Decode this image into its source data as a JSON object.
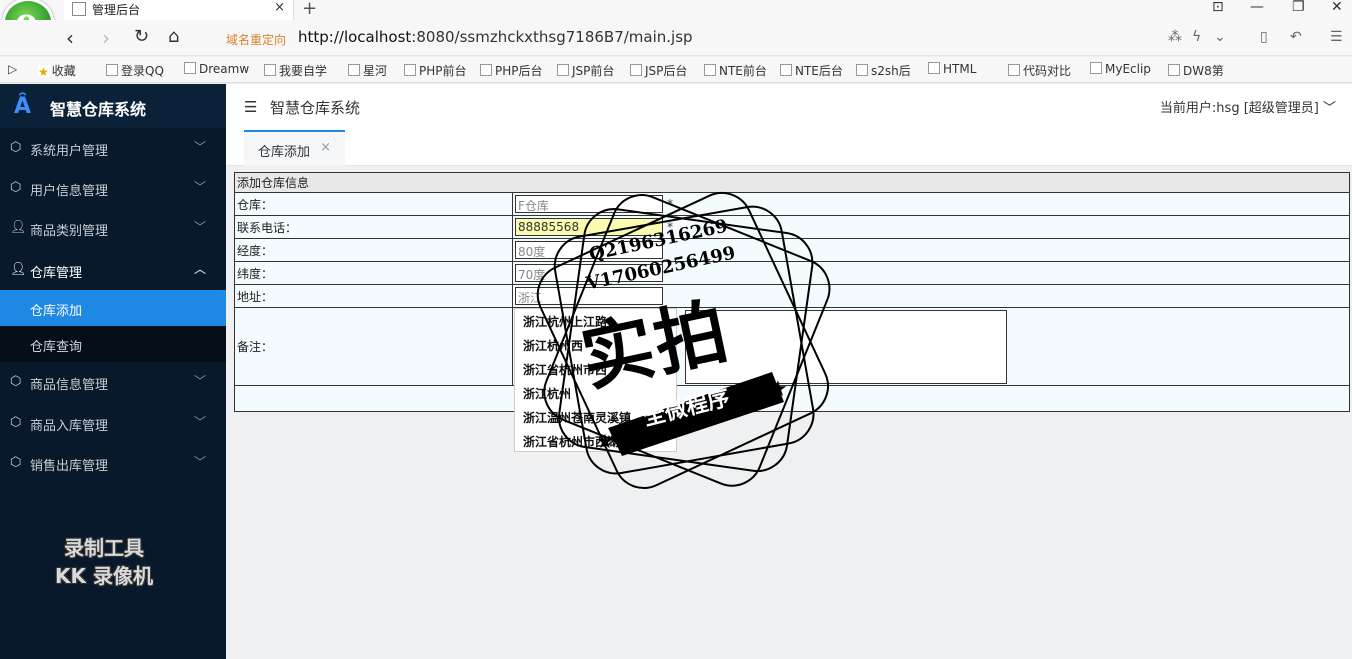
{
  "browser": {
    "tab_title": "管理后台",
    "tab_close": "×",
    "new_tab": "+",
    "redirect_label": "域名重定向",
    "url_host": "http://localhost",
    "url_rest": ":8080/ssmzhckxthsg7186B7/main.jsp",
    "bookmarks": [
      "收藏",
      "登录QQ",
      "Dreamw",
      "我要自学",
      "星河",
      "PHP前台",
      "PHP后台",
      "JSP前台",
      "JSP后台",
      "NTE前台",
      "NTE后台",
      "s2sh后",
      "HTML",
      "代码对比",
      "MyEclip",
      "DW8第"
    ]
  },
  "sidebar": {
    "brand": "智慧仓库系统",
    "menus": [
      {
        "label": "系统用户管理"
      },
      {
        "label": "用户信息管理"
      },
      {
        "label": "商品类别管理"
      },
      {
        "label": "仓库管理"
      },
      {
        "label": "商品信息管理"
      },
      {
        "label": "商品入库管理"
      },
      {
        "label": "销售出库管理"
      }
    ],
    "submenus": [
      {
        "label": "仓库添加"
      },
      {
        "label": "仓库查询"
      }
    ],
    "watermark_line1": "录制工具",
    "watermark_line2": "KK 录像机"
  },
  "topbar": {
    "title": "智慧仓库系统",
    "user": "当前用户:hsg [超级管理员]",
    "tab_label": "仓库添加"
  },
  "form": {
    "header": "添加仓库信息",
    "rows": [
      {
        "label": "仓库：",
        "value": "F仓库"
      },
      {
        "label": "联系电话：",
        "value": "88885568"
      },
      {
        "label": "经度：",
        "value": "80度"
      },
      {
        "label": "纬度：",
        "value": "70度"
      },
      {
        "label": "地址：",
        "value": "浙江"
      },
      {
        "label": "备注："
      }
    ],
    "required": "*"
  },
  "autocomplete": [
    "浙江杭州上江路",
    "浙江杭州西",
    "浙江省杭州市西",
    "浙江杭州",
    "浙江温州苍南灵溪镇",
    "浙江省杭州市西湖"
  ],
  "stamp": {
    "line1": "Q2196316269",
    "line2": "V17060256499",
    "big": "实拍",
    "banner": "全微程序"
  }
}
